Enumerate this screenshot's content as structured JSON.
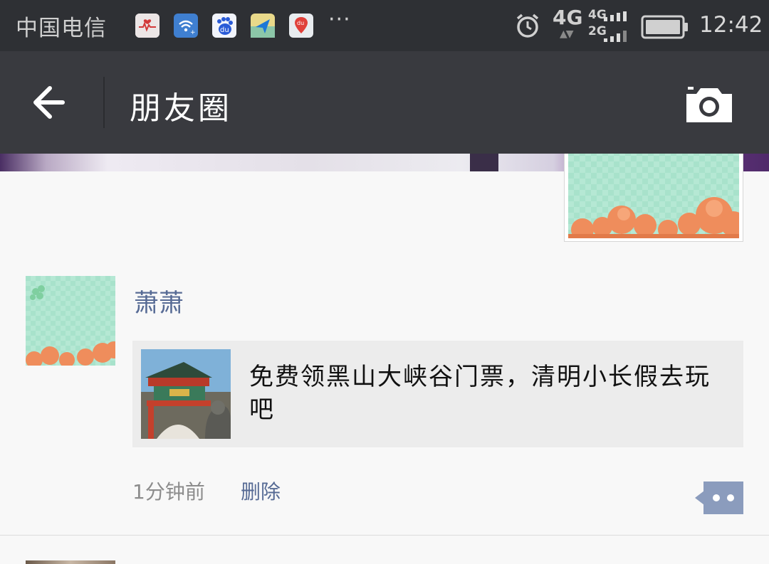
{
  "status_bar": {
    "carrier": "中国电信",
    "apps": [
      "health-app-icon",
      "wifi-app-icon",
      "baidu-app-icon",
      "maps-app-icon",
      "baidu-map-app-icon"
    ],
    "more": "···",
    "network_main": "4G",
    "network_sim2": [
      "4G",
      "2G"
    ],
    "time": "12:42"
  },
  "header": {
    "title": "朋友圈"
  },
  "post": {
    "author": "萧萧",
    "shared_link_text": "免费领黑山大峡谷门票，清明小长假去玩吧",
    "time": "1分钟前",
    "delete_label": "删除"
  },
  "colors": {
    "status_bar_bg": "#2e3034",
    "header_bg": "#393a3f",
    "link_blue": "#576b95",
    "page_bg": "#f8f8f8"
  }
}
